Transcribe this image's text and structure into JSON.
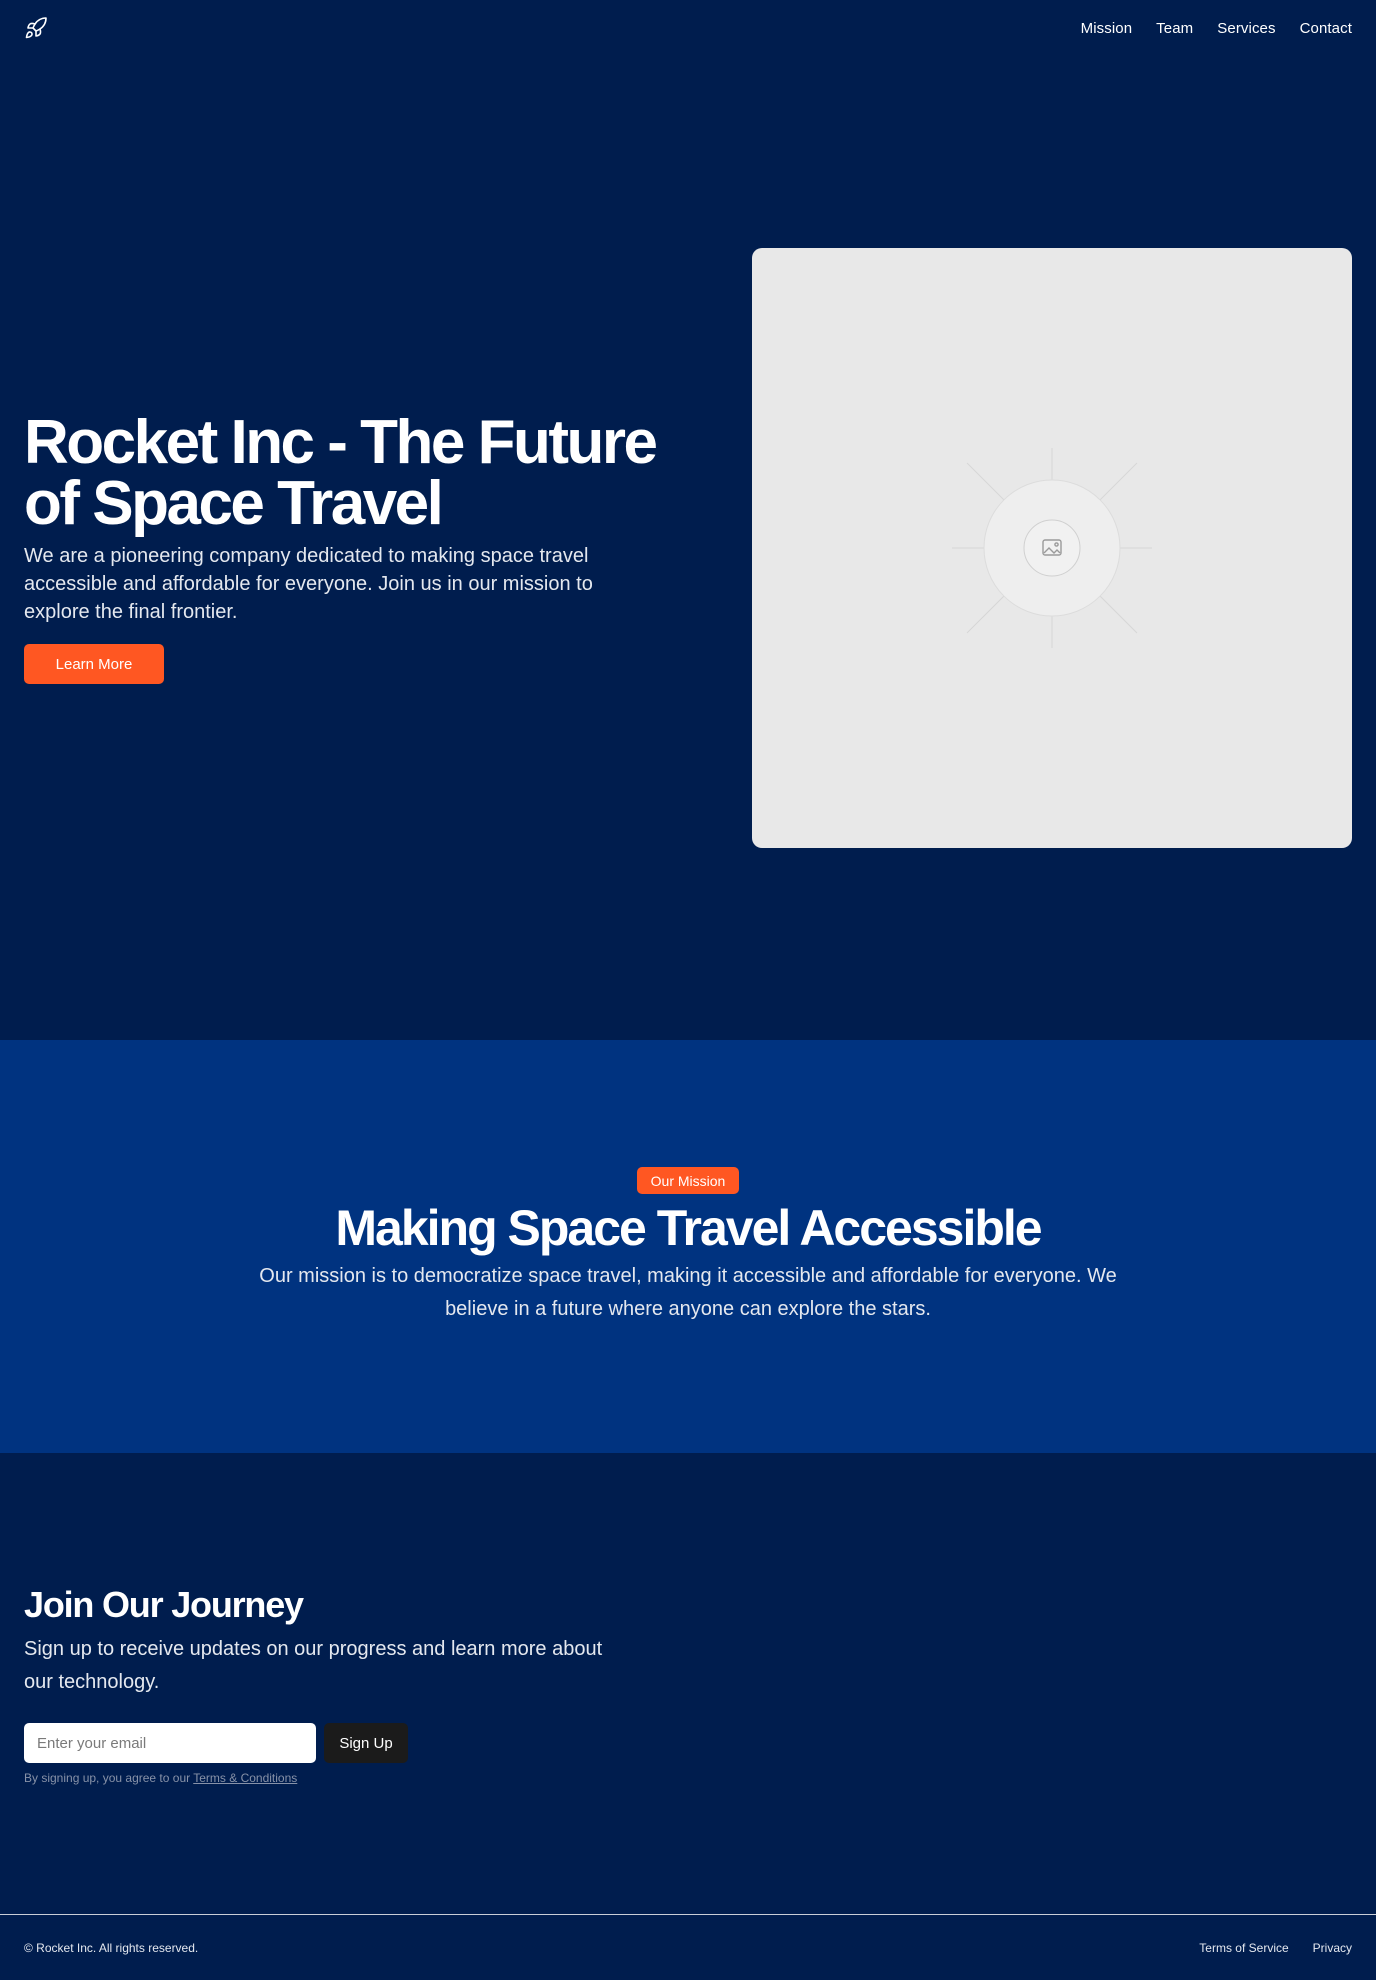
{
  "header": {
    "logo_icon": "rocket-icon",
    "nav": [
      {
        "label": "Mission"
      },
      {
        "label": "Team"
      },
      {
        "label": "Services"
      },
      {
        "label": "Contact"
      }
    ]
  },
  "hero": {
    "title": "Rocket Inc - The Future of Space Travel",
    "description": "We are a pioneering company dedicated to making space travel accessible and affordable for everyone. Join us in our mission to explore the final frontier.",
    "cta_label": "Learn More",
    "image_icon": "image-placeholder-icon"
  },
  "mission": {
    "badge": "Our Mission",
    "title": "Making Space Travel Accessible",
    "description": "Our mission is to democratize space travel, making it accessible and affordable for everyone. We believe in a future where anyone can explore the stars."
  },
  "signup": {
    "title": "Join Our Journey",
    "description": "Sign up to receive updates on our progress and learn more about our technology.",
    "email_placeholder": "Enter your email",
    "button_label": "Sign Up",
    "terms_prefix": "By signing up, you agree to our ",
    "terms_link": "Terms & Conditions"
  },
  "footer": {
    "copyright": "© Rocket Inc. All rights reserved.",
    "links": [
      {
        "label": "Terms of Service"
      },
      {
        "label": "Privacy"
      }
    ]
  },
  "colors": {
    "background": "#001d4e",
    "mission_background": "#003380",
    "accent": "#ff5722",
    "dark_button": "#1b1b1b",
    "image_placeholder": "#e8e8e8"
  }
}
